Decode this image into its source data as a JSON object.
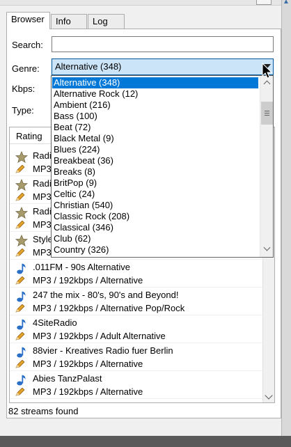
{
  "tabs": [
    {
      "label": "Browser",
      "active": true
    },
    {
      "label": "Info",
      "active": false
    },
    {
      "label": "Log",
      "active": false
    }
  ],
  "form": {
    "search_label": "Search:",
    "search_value": "",
    "genre_label": "Genre:",
    "genre_value": "Alternative (348)",
    "kbps_label": "Kbps:",
    "type_label": "Type:"
  },
  "list": {
    "header": "Rating",
    "rows": [
      {
        "title": "Radi",
        "subtitle": "MP3",
        "icon": "star-icon"
      },
      {
        "title": "Radi",
        "subtitle": "MP3",
        "icon": "star-icon"
      },
      {
        "title": "Radi",
        "subtitle": "MP3",
        "icon": "star-icon"
      },
      {
        "title": "Style",
        "subtitle": "MP3",
        "icon": "star-icon"
      },
      {
        "title": ".011FM - 90s Alternative",
        "subtitle": "MP3 / 192kbps / Alternative",
        "icon": "music-note-icon"
      },
      {
        "title": "247 the mix - 80's, 90's and Beyond!",
        "subtitle": "MP3 / 192kbps / Alternative Pop/Rock",
        "icon": "music-note-icon"
      },
      {
        "title": "4SiteRadio",
        "subtitle": "MP3 / 192kbps / Adult Alternative",
        "icon": "music-note-icon"
      },
      {
        "title": "88vier - Kreatives Radio fuer Berlin",
        "subtitle": "MP3 / 192kbps / Alternative",
        "icon": "music-note-icon"
      },
      {
        "title": "Abies TanzPalast",
        "subtitle": "MP3 / 192kbps / Alternative",
        "icon": "music-note-icon"
      }
    ]
  },
  "status": "82 streams found",
  "dropdown": {
    "options": [
      "Alternative (348)",
      "Alternative Rock (12)",
      "Ambient (216)",
      "Bass (100)",
      "Beat (72)",
      "Black Metal (9)",
      "Blues (224)",
      "Breakbeat (36)",
      "Breaks (8)",
      "BritPop (9)",
      "Celtic (24)",
      "Christian (540)",
      "Classic Rock (208)",
      "Classical (346)",
      "Club (62)",
      "Country (326)"
    ],
    "selected_index": 0
  },
  "colors": {
    "selection": "#0078d7",
    "combo_highlight": "#cce4f7",
    "note_icon": "#2a6fc7",
    "star_icon": "#a89a6a"
  }
}
